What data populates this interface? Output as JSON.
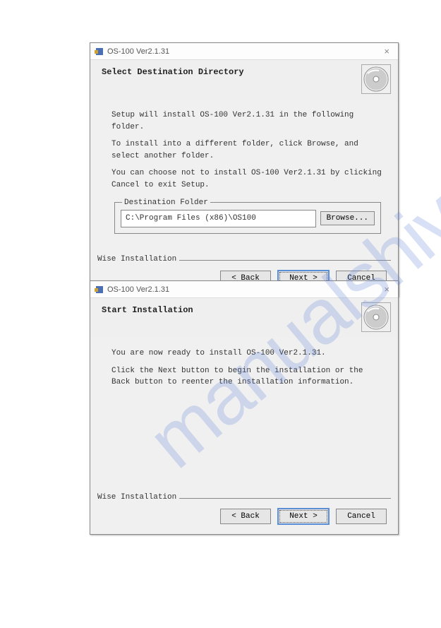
{
  "dialog1": {
    "title": "OS-100 Ver2.1.31",
    "heading": "Select Destination Directory",
    "para1": "Setup will install OS-100 Ver2.1.31 in the following folder.",
    "para2": "To install into a different folder, click Browse, and select another folder.",
    "para3": "You can choose not to install OS-100 Ver2.1.31 by clicking Cancel to exit Setup.",
    "dest_legend": "Destination Folder",
    "dest_path": "C:\\Program Files (x86)\\OS100",
    "browse": "Browse...",
    "wise": "Wise Installation",
    "back": "< Back",
    "next": "Next >",
    "cancel": "Cancel"
  },
  "dialog2": {
    "title": "OS-100 Ver2.1.31",
    "heading": "Start Installation",
    "para1": "You are now ready to install OS-100 Ver2.1.31.",
    "para2": "Click the Next button to begin the installation or the Back button to reenter the installation information.",
    "wise": "Wise Installation",
    "back": "< Back",
    "next": "Next >",
    "cancel": "Cancel"
  }
}
